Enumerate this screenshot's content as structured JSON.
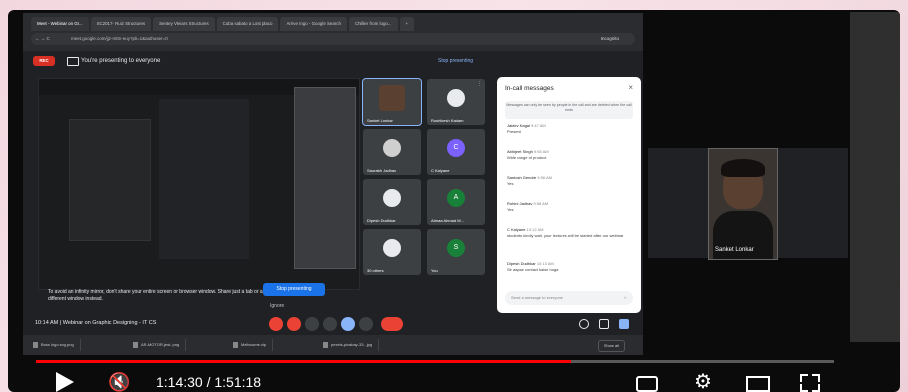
{
  "browser": {
    "tabs": [
      "Meet - Webinar on Gr...",
      "SC2017- Ruiz Structures",
      "Sentey Vleiars Structures",
      "Cuba sabato a Lost placo",
      "Arrive Ingo - Google Search",
      "Chillier from logo...",
      "+"
    ],
    "address": "meet.google.com/jjz-mttn-euy?pli=1&authuser=0",
    "nav": "← → C",
    "incognito": "Incognito"
  },
  "meet": {
    "rec_badge": "REC",
    "presenting_text": "You're presenting to everyone",
    "stop_presenting_top": "Stop presenting",
    "warning_text": "To avoid an infinity mirror, don't share your entire screen or browser window. Share just a tab or a different window instead.",
    "stop_presenting_button": "Stop presenting",
    "ignore": "Ignore",
    "clock": "10:14 AM  |  Webinar on Graphic Designing - IT CS",
    "participants": [
      {
        "name": "Sanket Lonkar",
        "avatar_color": "#5a4030",
        "initial": ""
      },
      {
        "name": "Rushikesh Kadam",
        "avatar_color": "#e8eaed",
        "initial": ""
      },
      {
        "name": "Saurabh Jadhav",
        "avatar_color": "#cfcfcf",
        "initial": ""
      },
      {
        "name": "C Kalyane",
        "avatar_color": "#7b61ff",
        "initial": "C"
      },
      {
        "name": "Dipesh Dudhkar",
        "avatar_color": "#e8eaed",
        "initial": ""
      },
      {
        "name": "Atmaa Ahmad M...",
        "avatar_color": "#188038",
        "initial": "A"
      },
      {
        "name": "30 others",
        "avatar_color": "#e8eaed",
        "initial": ""
      },
      {
        "name": "You",
        "avatar_color": "#188038",
        "initial": "S"
      }
    ]
  },
  "chat": {
    "title": "In-call messages",
    "note": "Messages can only be seen by people in the call and are deleted when the call ends",
    "messages": [
      {
        "who": "Jaidev Kagal",
        "when": "9:47 AM",
        "text": "Present"
      },
      {
        "who": "Abhijeet Singh",
        "when": "9:55 AM",
        "text": "Wide range of product"
      },
      {
        "who": "Santosh Gendre",
        "when": "9:56 AM",
        "text": "Yes"
      },
      {
        "who": "Rohini Jadhav",
        "when": "9:58 AM",
        "text": "Yes"
      },
      {
        "who": "C Kalyane",
        "when": "10:12 AM",
        "text": "students kindly wait, your lectures will be started after our webinar"
      },
      {
        "who": "Dipesh Dudhkar",
        "when": "10:13 AM",
        "text": "Sir aapse contact kaise hoga"
      }
    ],
    "input_placeholder": "Send a message to everyone"
  },
  "downloads": {
    "items": [
      "Boss logo.svg.png",
      "AR-MOTOR-jest..png",
      "Melbourne.zip",
      "pexels-pixabay-33...jpg"
    ],
    "show_all": "Show all"
  },
  "self_view": {
    "name": "Sanket Lonkar"
  },
  "player": {
    "time": "1:14:30 / 1:51:18",
    "progress": 0.67
  }
}
